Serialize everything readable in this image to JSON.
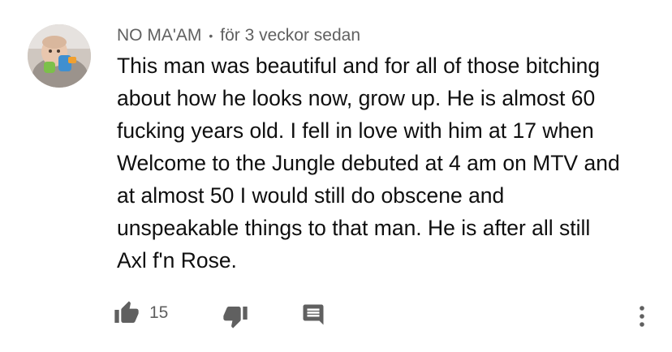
{
  "comment": {
    "author": "NO MA'AM",
    "separator": "•",
    "timestamp": "för 3 veckor sedan",
    "text_lines": [
      "This man was beautiful and for all of those bitching",
      "about how he looks now, grow up. He is almost 60",
      "fucking years old. I fell in love with him at 17 when",
      "Welcome to the Jungle debuted at 4 am on MTV and",
      "at almost 50 I would still do obscene and",
      "unspeakable things to that man. He is after all still",
      "Axl f'n Rose."
    ],
    "like_count": "15",
    "icons": {
      "like": "thumbs-up-icon",
      "dislike": "thumbs-down-icon",
      "reply": "comment-reply-icon",
      "more": "more-vertical-icon"
    },
    "colors": {
      "text": "#0f0f0f",
      "secondary": "#606060",
      "icon": "#606060"
    }
  }
}
